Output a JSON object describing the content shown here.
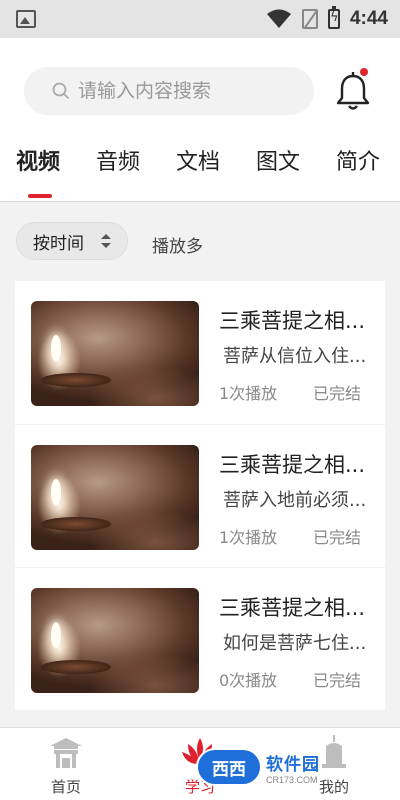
{
  "statusbar": {
    "time": "4:44"
  },
  "search": {
    "placeholder": "请输入内容搜索"
  },
  "tabs": [
    {
      "label": "视频",
      "active": true
    },
    {
      "label": "音频",
      "active": false
    },
    {
      "label": "文档",
      "active": false
    },
    {
      "label": "图文",
      "active": false
    },
    {
      "label": "简介",
      "active": false
    }
  ],
  "sort": {
    "time_label": "按时间",
    "plays_label": "播放多"
  },
  "items": [
    {
      "title": "三乘菩提之相...",
      "subtitle": "菩萨从信位入住...",
      "plays": "1次播放",
      "status": "已完结"
    },
    {
      "title": "三乘菩提之相...",
      "subtitle": "菩萨入地前必须...",
      "plays": "1次播放",
      "status": "已完结"
    },
    {
      "title": "三乘菩提之相...",
      "subtitle": "如何是菩萨七住...",
      "plays": "0次播放",
      "status": "已完结"
    }
  ],
  "bottom_nav": [
    {
      "label": "首页",
      "icon": "temple-icon",
      "active": false
    },
    {
      "label": "学习",
      "icon": "lotus-icon",
      "active": true
    },
    {
      "label": "我的",
      "icon": "pagoda-icon",
      "active": false
    }
  ],
  "watermark": {
    "badge": "西西",
    "main": "软件园",
    "sub": "CR173.COM"
  },
  "colors": {
    "accent": "#e0212f",
    "watermark": "#1e6fd9"
  }
}
